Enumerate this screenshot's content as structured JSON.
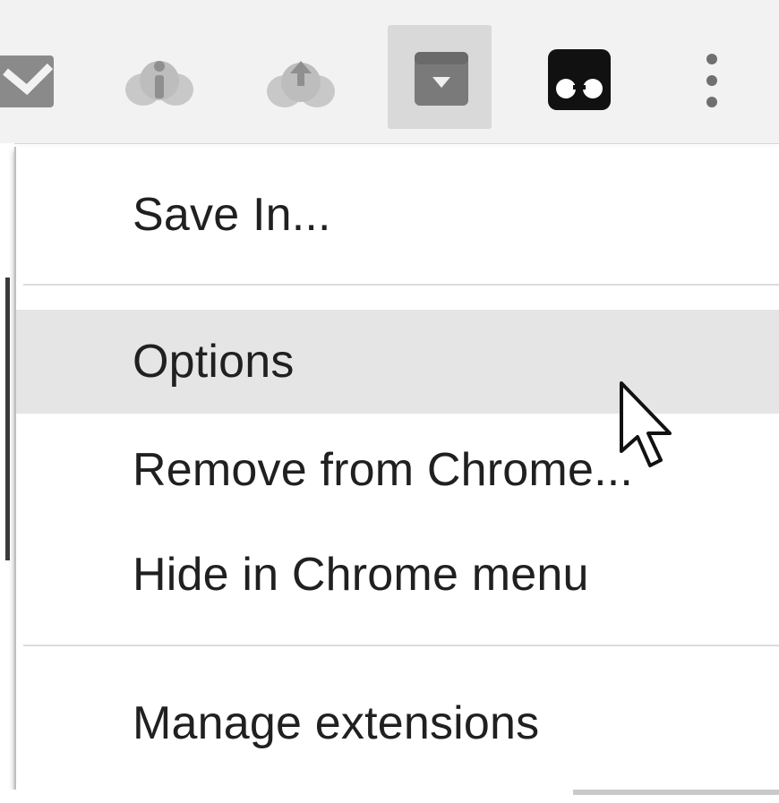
{
  "toolbar": {
    "icons": [
      {
        "name": "inbox-icon"
      },
      {
        "name": "cloud-info-icon"
      },
      {
        "name": "cloud-upload-icon"
      },
      {
        "name": "save-in-extension-icon"
      },
      {
        "name": "glasses-extension-icon"
      },
      {
        "name": "more-vertical-icon"
      }
    ]
  },
  "menu": {
    "items": [
      {
        "label": "Save In..."
      },
      {
        "label": "Options"
      },
      {
        "label": "Remove from Chrome..."
      },
      {
        "label": "Hide in Chrome menu"
      },
      {
        "label": "Manage extensions"
      }
    ],
    "hovered_item": "Options"
  },
  "colors": {
    "toolbar_bg": "#f2f2f2",
    "hover_bg": "#e5e5e5",
    "text": "#202020",
    "separator": "#dcdcdc"
  }
}
